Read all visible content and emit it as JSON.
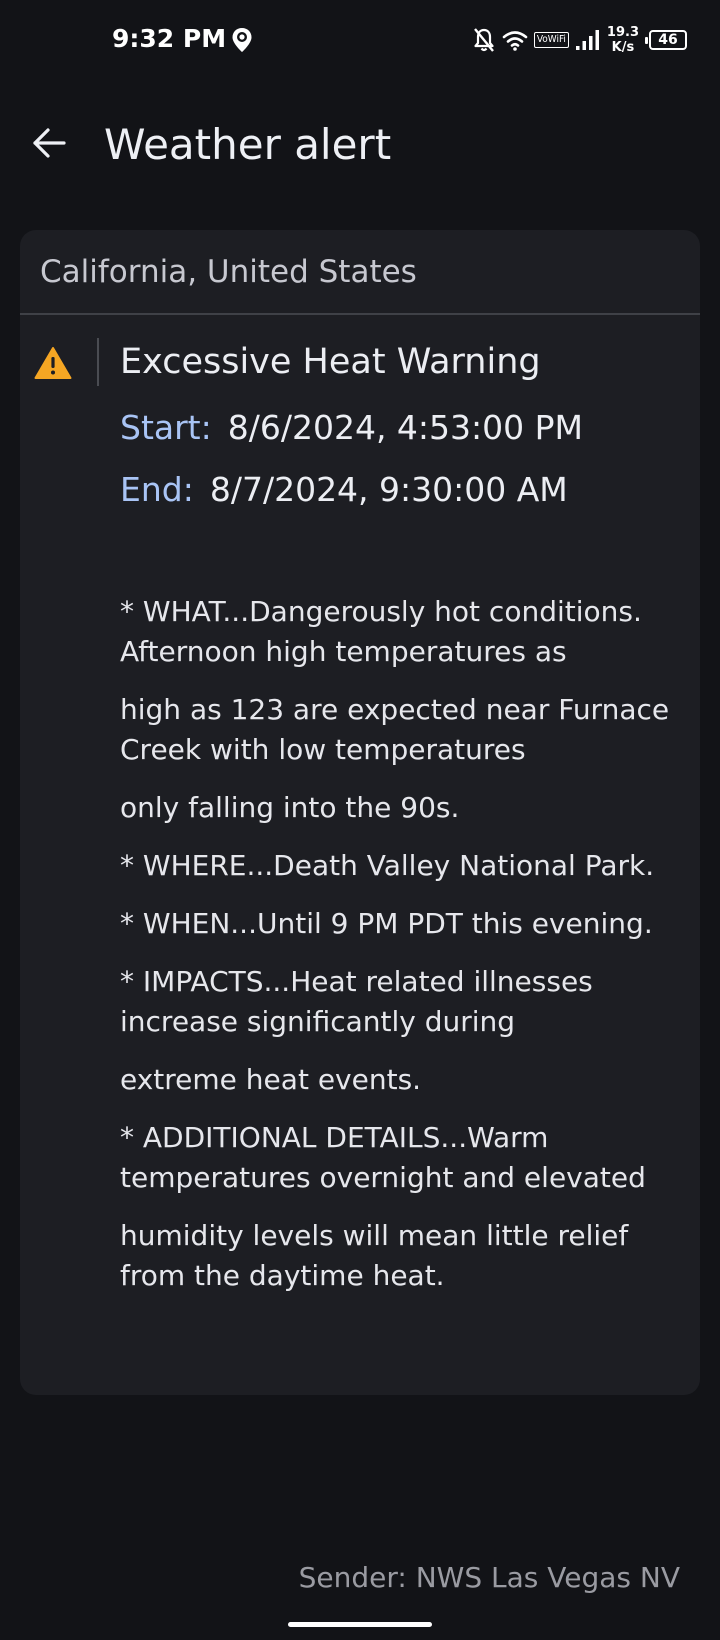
{
  "status_bar": {
    "time": "9:32 PM",
    "vowifi_label": "VoWiFi",
    "net_speed_value": "19.3",
    "net_speed_unit": "K/s",
    "battery_level": "46"
  },
  "app_bar": {
    "title": "Weather alert"
  },
  "alert": {
    "location": "California, United States",
    "title": "Excessive Heat Warning",
    "start_label": "Start:",
    "start_value": "8/6/2024, 4:53:00 PM",
    "end_label": "End:",
    "end_value": "8/7/2024, 9:30:00 AM",
    "paragraphs": [
      "* WHAT...Dangerously hot conditions. Afternoon high temperatures as",
      "high as 123 are expected near Furnace Creek with low temperatures",
      "only falling into the 90s.",
      "* WHERE...Death Valley National Park.",
      "* WHEN...Until 9 PM PDT this evening.",
      "* IMPACTS...Heat related illnesses increase significantly during",
      "extreme heat events.",
      "* ADDITIONAL DETAILS...Warm temperatures overnight and elevated",
      "humidity levels will mean little relief from the daytime heat."
    ],
    "sender": "Sender: NWS Las Vegas NV"
  },
  "colors": {
    "background": "#121317",
    "card": "#1d1e23",
    "accent_label": "#a9c4f5",
    "warning": "#f5a623"
  }
}
